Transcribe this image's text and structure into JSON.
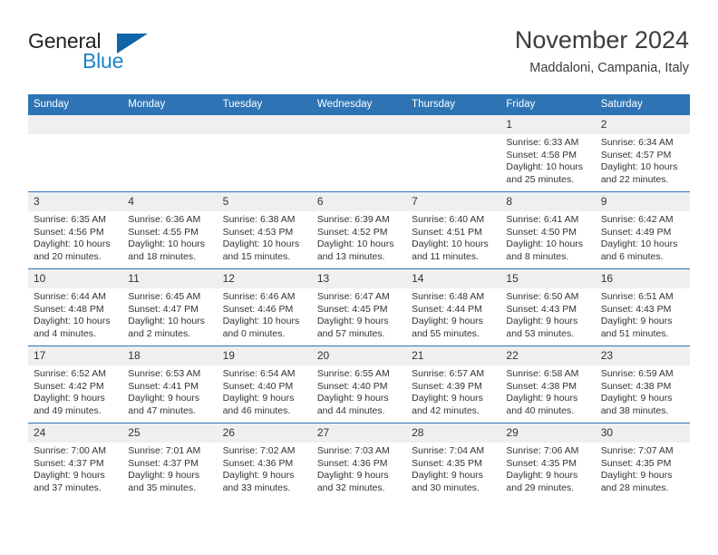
{
  "brand": {
    "name_part1": "General",
    "name_part2": "Blue",
    "flag_icon": "blue-flag-triangle"
  },
  "header": {
    "month_title": "November 2024",
    "location": "Maddaloni, Campania, Italy"
  },
  "accent_colors": {
    "header_blue": "#2e74b5",
    "logo_blue": "#1b83c6",
    "flag_blue": "#1065a8",
    "daynum_gray": "#efefef"
  },
  "weekday_headers": [
    "Sunday",
    "Monday",
    "Tuesday",
    "Wednesday",
    "Thursday",
    "Friday",
    "Saturday"
  ],
  "weeks": [
    [
      {
        "day": "",
        "sunrise": "",
        "sunset": "",
        "daylight": "",
        "empty": true
      },
      {
        "day": "",
        "sunrise": "",
        "sunset": "",
        "daylight": "",
        "empty": true
      },
      {
        "day": "",
        "sunrise": "",
        "sunset": "",
        "daylight": "",
        "empty": true
      },
      {
        "day": "",
        "sunrise": "",
        "sunset": "",
        "daylight": "",
        "empty": true
      },
      {
        "day": "",
        "sunrise": "",
        "sunset": "",
        "daylight": "",
        "empty": true
      },
      {
        "day": "1",
        "sunrise": "Sunrise: 6:33 AM",
        "sunset": "Sunset: 4:58 PM",
        "daylight": "Daylight: 10 hours and 25 minutes.",
        "empty": false
      },
      {
        "day": "2",
        "sunrise": "Sunrise: 6:34 AM",
        "sunset": "Sunset: 4:57 PM",
        "daylight": "Daylight: 10 hours and 22 minutes.",
        "empty": false
      }
    ],
    [
      {
        "day": "3",
        "sunrise": "Sunrise: 6:35 AM",
        "sunset": "Sunset: 4:56 PM",
        "daylight": "Daylight: 10 hours and 20 minutes.",
        "empty": false
      },
      {
        "day": "4",
        "sunrise": "Sunrise: 6:36 AM",
        "sunset": "Sunset: 4:55 PM",
        "daylight": "Daylight: 10 hours and 18 minutes.",
        "empty": false
      },
      {
        "day": "5",
        "sunrise": "Sunrise: 6:38 AM",
        "sunset": "Sunset: 4:53 PM",
        "daylight": "Daylight: 10 hours and 15 minutes.",
        "empty": false
      },
      {
        "day": "6",
        "sunrise": "Sunrise: 6:39 AM",
        "sunset": "Sunset: 4:52 PM",
        "daylight": "Daylight: 10 hours and 13 minutes.",
        "empty": false
      },
      {
        "day": "7",
        "sunrise": "Sunrise: 6:40 AM",
        "sunset": "Sunset: 4:51 PM",
        "daylight": "Daylight: 10 hours and 11 minutes.",
        "empty": false
      },
      {
        "day": "8",
        "sunrise": "Sunrise: 6:41 AM",
        "sunset": "Sunset: 4:50 PM",
        "daylight": "Daylight: 10 hours and 8 minutes.",
        "empty": false
      },
      {
        "day": "9",
        "sunrise": "Sunrise: 6:42 AM",
        "sunset": "Sunset: 4:49 PM",
        "daylight": "Daylight: 10 hours and 6 minutes.",
        "empty": false
      }
    ],
    [
      {
        "day": "10",
        "sunrise": "Sunrise: 6:44 AM",
        "sunset": "Sunset: 4:48 PM",
        "daylight": "Daylight: 10 hours and 4 minutes.",
        "empty": false
      },
      {
        "day": "11",
        "sunrise": "Sunrise: 6:45 AM",
        "sunset": "Sunset: 4:47 PM",
        "daylight": "Daylight: 10 hours and 2 minutes.",
        "empty": false
      },
      {
        "day": "12",
        "sunrise": "Sunrise: 6:46 AM",
        "sunset": "Sunset: 4:46 PM",
        "daylight": "Daylight: 10 hours and 0 minutes.",
        "empty": false
      },
      {
        "day": "13",
        "sunrise": "Sunrise: 6:47 AM",
        "sunset": "Sunset: 4:45 PM",
        "daylight": "Daylight: 9 hours and 57 minutes.",
        "empty": false
      },
      {
        "day": "14",
        "sunrise": "Sunrise: 6:48 AM",
        "sunset": "Sunset: 4:44 PM",
        "daylight": "Daylight: 9 hours and 55 minutes.",
        "empty": false
      },
      {
        "day": "15",
        "sunrise": "Sunrise: 6:50 AM",
        "sunset": "Sunset: 4:43 PM",
        "daylight": "Daylight: 9 hours and 53 minutes.",
        "empty": false
      },
      {
        "day": "16",
        "sunrise": "Sunrise: 6:51 AM",
        "sunset": "Sunset: 4:43 PM",
        "daylight": "Daylight: 9 hours and 51 minutes.",
        "empty": false
      }
    ],
    [
      {
        "day": "17",
        "sunrise": "Sunrise: 6:52 AM",
        "sunset": "Sunset: 4:42 PM",
        "daylight": "Daylight: 9 hours and 49 minutes.",
        "empty": false
      },
      {
        "day": "18",
        "sunrise": "Sunrise: 6:53 AM",
        "sunset": "Sunset: 4:41 PM",
        "daylight": "Daylight: 9 hours and 47 minutes.",
        "empty": false
      },
      {
        "day": "19",
        "sunrise": "Sunrise: 6:54 AM",
        "sunset": "Sunset: 4:40 PM",
        "daylight": "Daylight: 9 hours and 46 minutes.",
        "empty": false
      },
      {
        "day": "20",
        "sunrise": "Sunrise: 6:55 AM",
        "sunset": "Sunset: 4:40 PM",
        "daylight": "Daylight: 9 hours and 44 minutes.",
        "empty": false
      },
      {
        "day": "21",
        "sunrise": "Sunrise: 6:57 AM",
        "sunset": "Sunset: 4:39 PM",
        "daylight": "Daylight: 9 hours and 42 minutes.",
        "empty": false
      },
      {
        "day": "22",
        "sunrise": "Sunrise: 6:58 AM",
        "sunset": "Sunset: 4:38 PM",
        "daylight": "Daylight: 9 hours and 40 minutes.",
        "empty": false
      },
      {
        "day": "23",
        "sunrise": "Sunrise: 6:59 AM",
        "sunset": "Sunset: 4:38 PM",
        "daylight": "Daylight: 9 hours and 38 minutes.",
        "empty": false
      }
    ],
    [
      {
        "day": "24",
        "sunrise": "Sunrise: 7:00 AM",
        "sunset": "Sunset: 4:37 PM",
        "daylight": "Daylight: 9 hours and 37 minutes.",
        "empty": false
      },
      {
        "day": "25",
        "sunrise": "Sunrise: 7:01 AM",
        "sunset": "Sunset: 4:37 PM",
        "daylight": "Daylight: 9 hours and 35 minutes.",
        "empty": false
      },
      {
        "day": "26",
        "sunrise": "Sunrise: 7:02 AM",
        "sunset": "Sunset: 4:36 PM",
        "daylight": "Daylight: 9 hours and 33 minutes.",
        "empty": false
      },
      {
        "day": "27",
        "sunrise": "Sunrise: 7:03 AM",
        "sunset": "Sunset: 4:36 PM",
        "daylight": "Daylight: 9 hours and 32 minutes.",
        "empty": false
      },
      {
        "day": "28",
        "sunrise": "Sunrise: 7:04 AM",
        "sunset": "Sunset: 4:35 PM",
        "daylight": "Daylight: 9 hours and 30 minutes.",
        "empty": false
      },
      {
        "day": "29",
        "sunrise": "Sunrise: 7:06 AM",
        "sunset": "Sunset: 4:35 PM",
        "daylight": "Daylight: 9 hours and 29 minutes.",
        "empty": false
      },
      {
        "day": "30",
        "sunrise": "Sunrise: 7:07 AM",
        "sunset": "Sunset: 4:35 PM",
        "daylight": "Daylight: 9 hours and 28 minutes.",
        "empty": false
      }
    ]
  ]
}
